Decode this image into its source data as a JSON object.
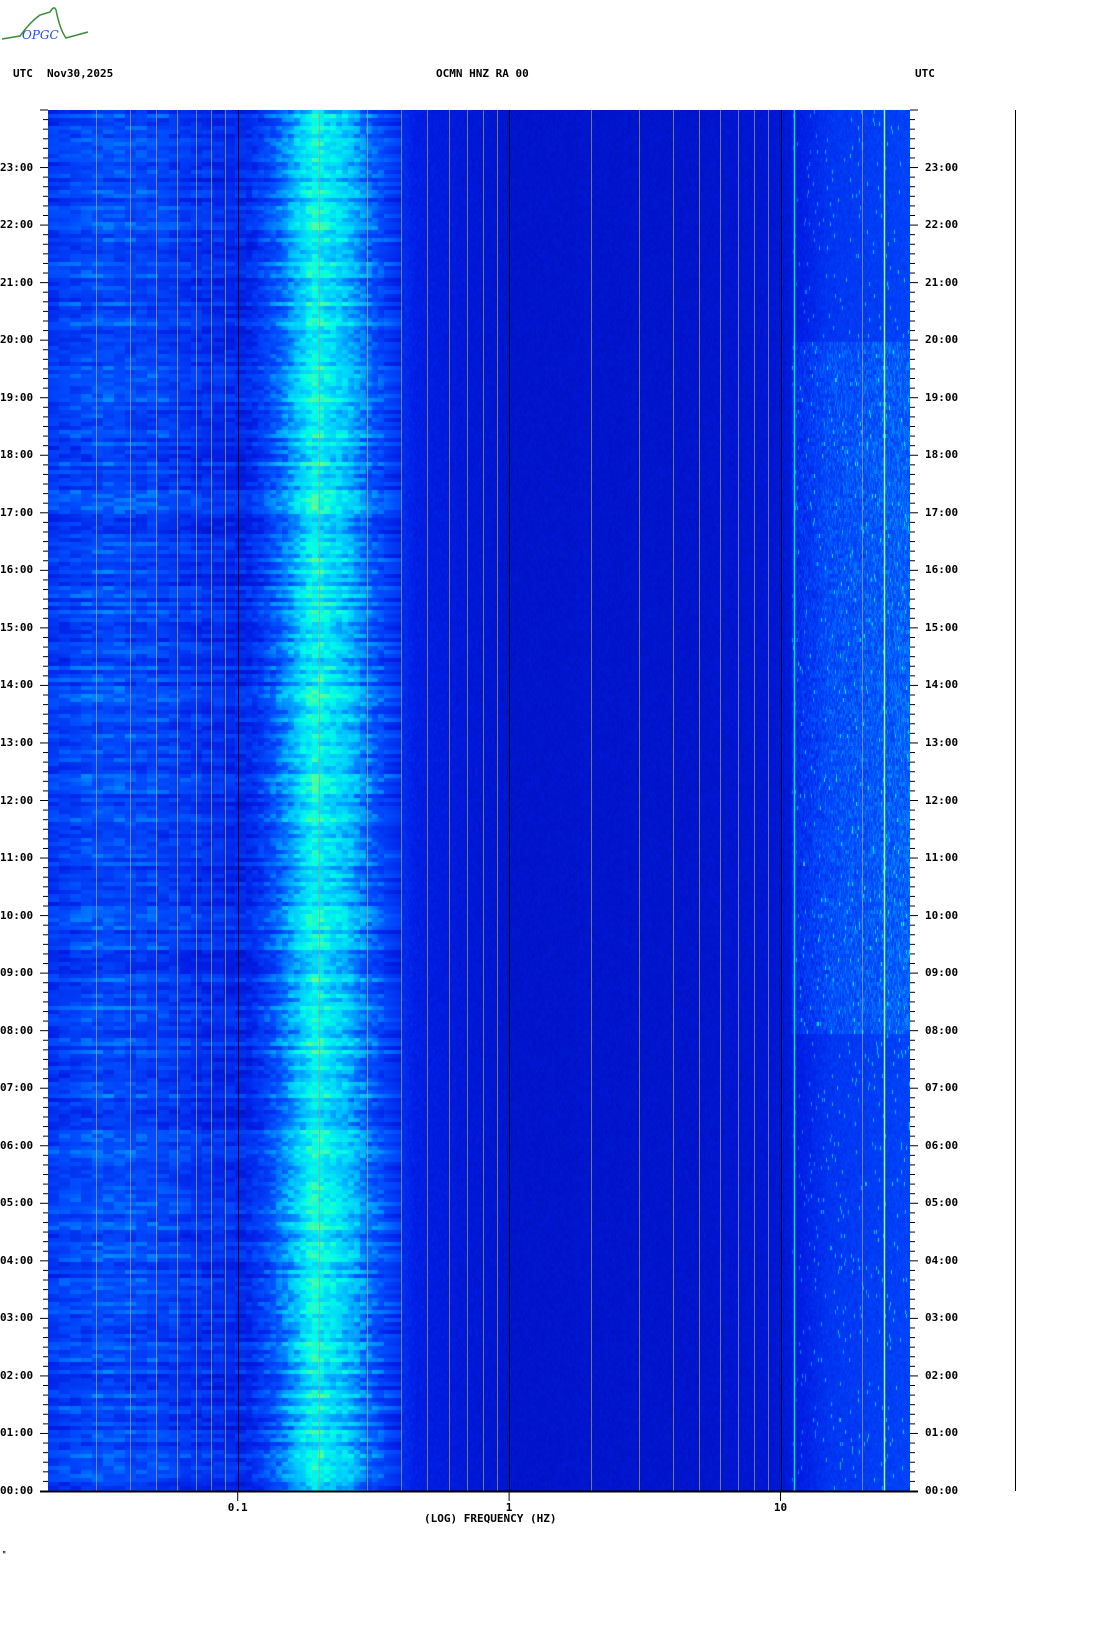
{
  "header": {
    "logo_text": "OPGC",
    "left_label": "UTC",
    "date": "Nov30,2025",
    "station": "OCMN HNZ RA 00",
    "right_label": "UTC"
  },
  "footer_mark": "ᴹ",
  "chart_data": {
    "type": "heatmap",
    "title": "OCMN HNZ RA 00",
    "xlabel": "(LOG) FREQUENCY (HZ)",
    "ylabel": "UTC",
    "x_scale": "log",
    "xlim": [
      0.02,
      30
    ],
    "ylim_hours": [
      0,
      24
    ],
    "x_ticks": [
      {
        "value": 0.1,
        "label": "0.1"
      },
      {
        "value": 1,
        "label": "1"
      },
      {
        "value": 10,
        "label": "10"
      }
    ],
    "y_ticks": [
      "00:00",
      "01:00",
      "02:00",
      "03:00",
      "04:00",
      "05:00",
      "06:00",
      "07:00",
      "08:00",
      "09:00",
      "10:00",
      "11:00",
      "12:00",
      "13:00",
      "14:00",
      "15:00",
      "16:00",
      "17:00",
      "18:00",
      "19:00",
      "20:00",
      "21:00",
      "22:00",
      "23:00"
    ],
    "gridlines_hz": [
      0.03,
      0.04,
      0.05,
      0.06,
      0.07,
      0.08,
      0.09,
      0.1,
      0.2,
      0.3,
      0.4,
      0.5,
      0.6,
      0.7,
      0.8,
      0.9,
      1,
      2,
      3,
      4,
      5,
      6,
      7,
      8,
      9,
      10,
      20,
      30
    ],
    "relative_power_profile": [
      {
        "freq": 0.02,
        "level": 0.33
      },
      {
        "freq": 0.03,
        "level": 0.38
      },
      {
        "freq": 0.05,
        "level": 0.36
      },
      {
        "freq": 0.08,
        "level": 0.3
      },
      {
        "freq": 0.11,
        "level": 0.28
      },
      {
        "freq": 0.14,
        "level": 0.42
      },
      {
        "freq": 0.19,
        "level": 0.64
      },
      {
        "freq": 0.25,
        "level": 0.55
      },
      {
        "freq": 0.32,
        "level": 0.4
      },
      {
        "freq": 0.45,
        "level": 0.25
      },
      {
        "freq": 1,
        "level": 0.18
      },
      {
        "freq": 5,
        "level": 0.18
      },
      {
        "freq": 10,
        "level": 0.2
      },
      {
        "freq": 15,
        "level": 0.32
      },
      {
        "freq": 30,
        "level": 0.36
      }
    ],
    "spectral_lines_hz": [
      11.2,
      24
    ],
    "daytime_hf_noise_hours": [
      8,
      20
    ],
    "colormap": [
      "#00008c",
      "#001ee6",
      "#0050ff",
      "#00c8ff",
      "#00ffe6",
      "#78ff78",
      "#ffff00",
      "#ff0000"
    ]
  }
}
